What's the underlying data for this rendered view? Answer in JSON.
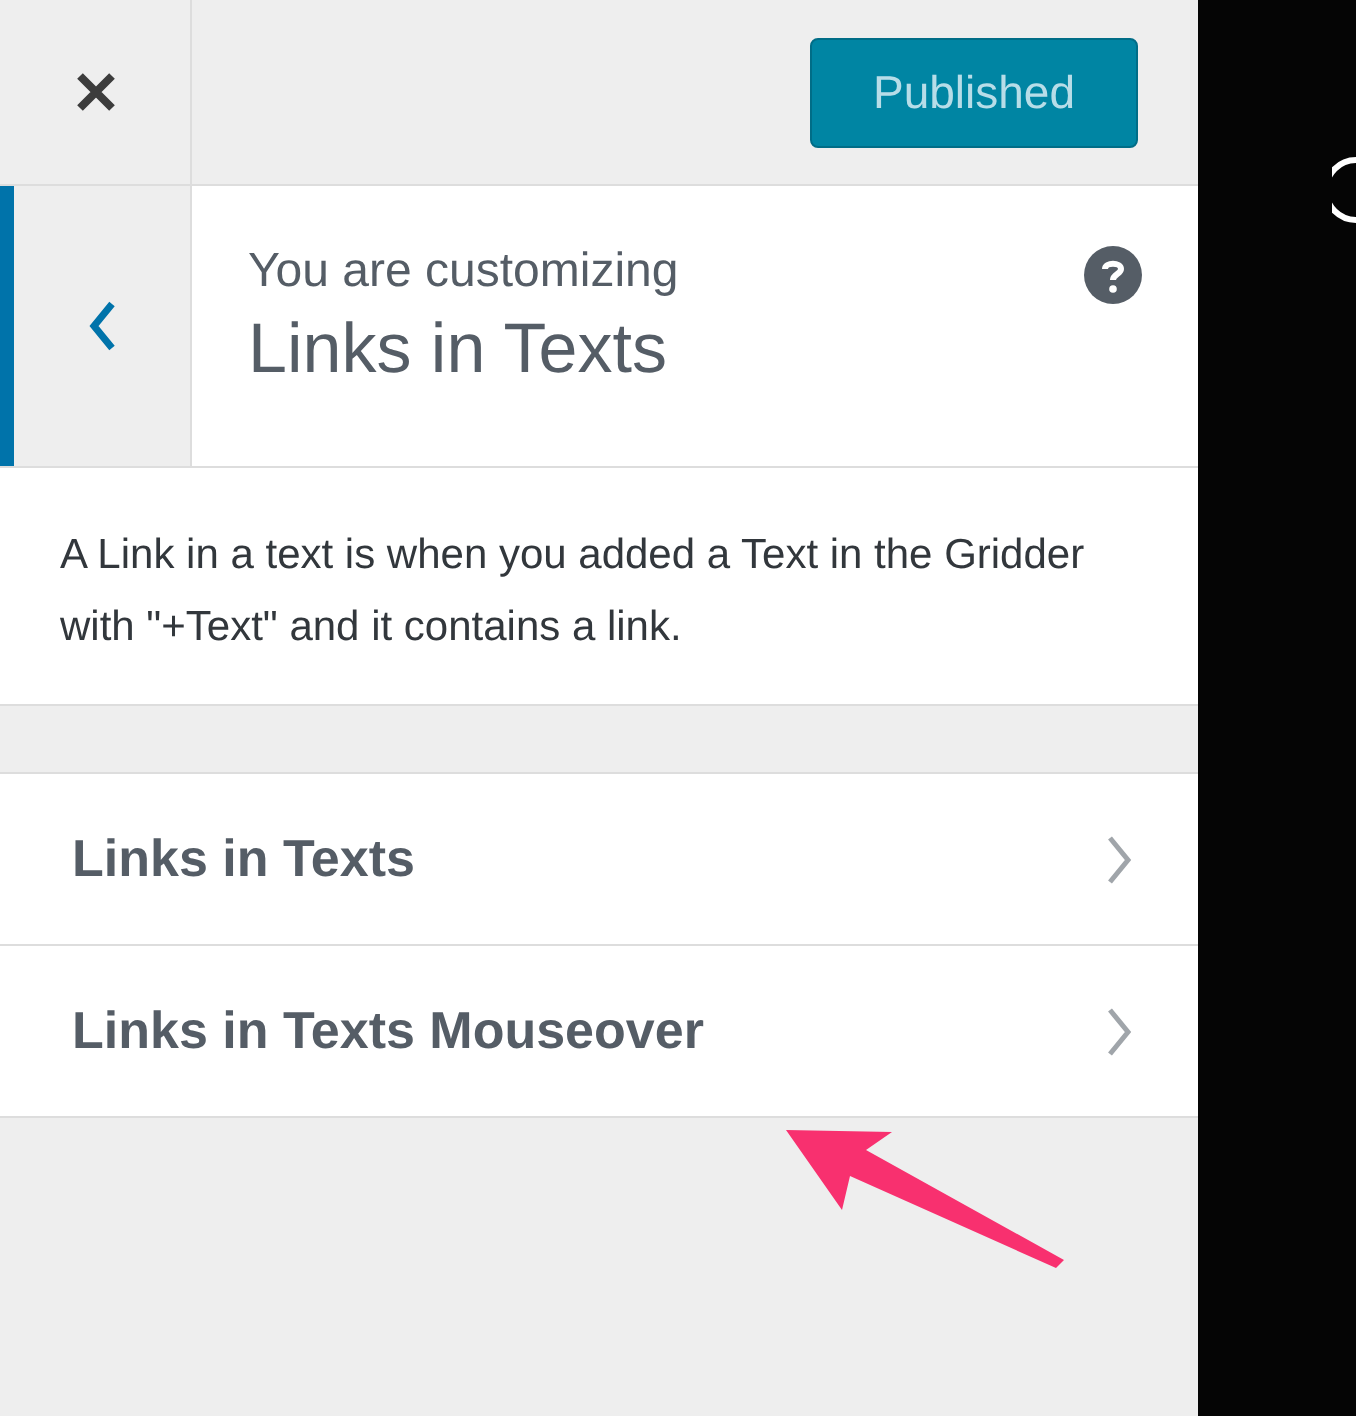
{
  "header": {
    "publish_button": "Published"
  },
  "section": {
    "eyebrow": "You are customizing",
    "title": "Links in Texts"
  },
  "description": "A Link in a text is when you added a Text in the Gridder with \"+Text\" and it contains a link.",
  "items": [
    {
      "label": "Links in Texts"
    },
    {
      "label": "Links in Texts Mouseover"
    }
  ]
}
